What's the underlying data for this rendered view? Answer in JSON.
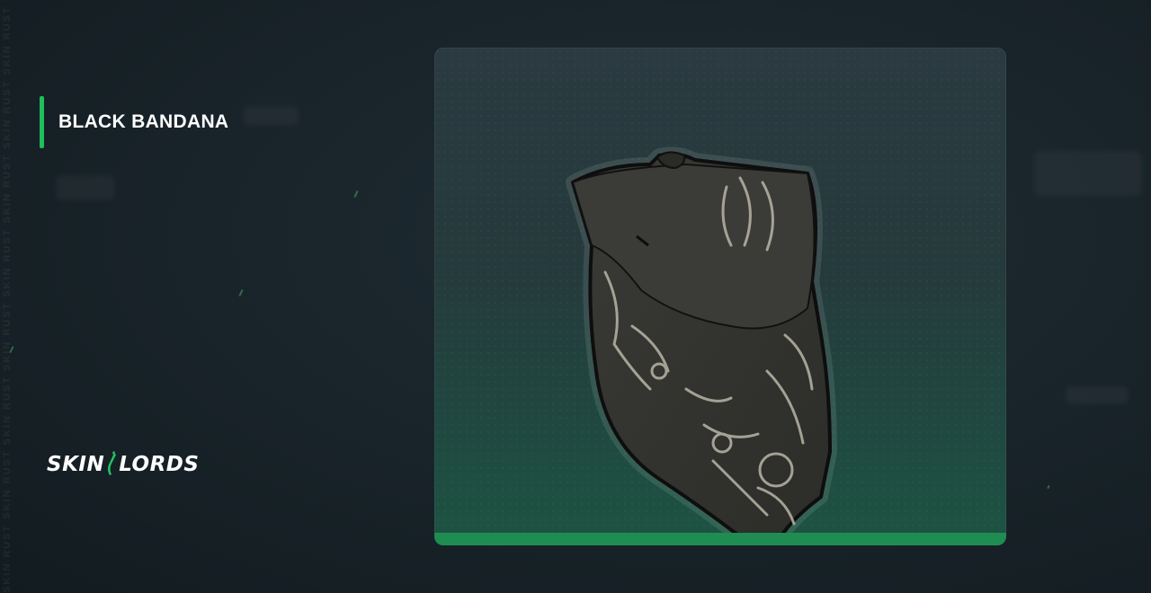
{
  "item": {
    "name": "BLACK BANDANA"
  },
  "brand": {
    "logo_left": "SKIN",
    "logo_right": "LORDS"
  },
  "background": {
    "side_watermark": "SKIN RUST SKIN RUST SKIN RUST SKIN RUST SKIN RUST SKIN RUST SKIN RUST SKIN RUST SKIN RUST SKIN"
  },
  "colors": {
    "accent": "#1fbf5c",
    "card_bottom_bar": "#1f8c52",
    "background": "#182329",
    "title_text": "#ffffff"
  }
}
